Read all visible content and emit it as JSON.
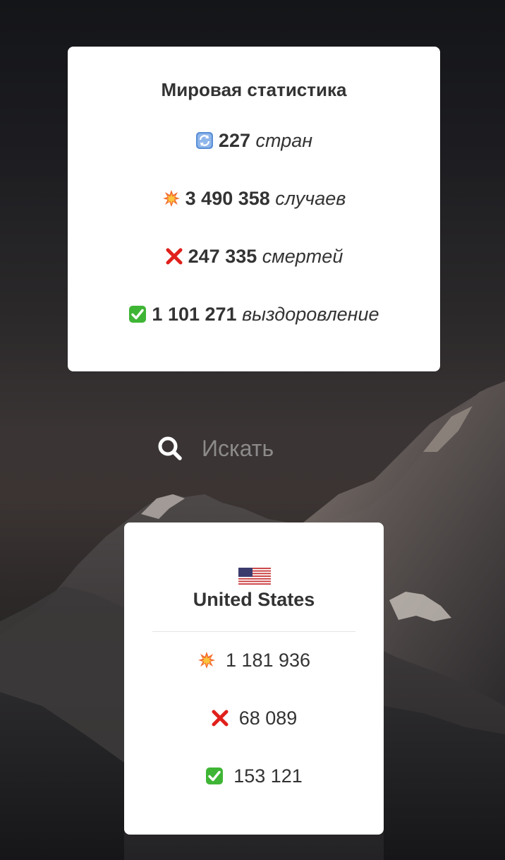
{
  "world": {
    "title": "Мировая статистика",
    "countries": {
      "value": "227",
      "label": "стран",
      "icon": "refresh-icon"
    },
    "cases": {
      "value": "3 490 358",
      "label": "случаев",
      "icon": "collision-icon"
    },
    "deaths": {
      "value": "247 335",
      "label": "смертей",
      "icon": "cross-mark-icon"
    },
    "recovered": {
      "value": "1 101 271",
      "label": "выздоровление",
      "icon": "check-mark-icon"
    }
  },
  "search": {
    "placeholder": "Искать",
    "value": ""
  },
  "country": {
    "name": "United States",
    "flag": "us-flag-icon",
    "cases": "1 181 936",
    "deaths": "68 089",
    "recovered": "153 121"
  },
  "colors": {
    "card": "#ffffff",
    "text": "#333333",
    "cross": "#e0201b",
    "check": "#3fb535",
    "refresh": "#5a8fd6"
  }
}
